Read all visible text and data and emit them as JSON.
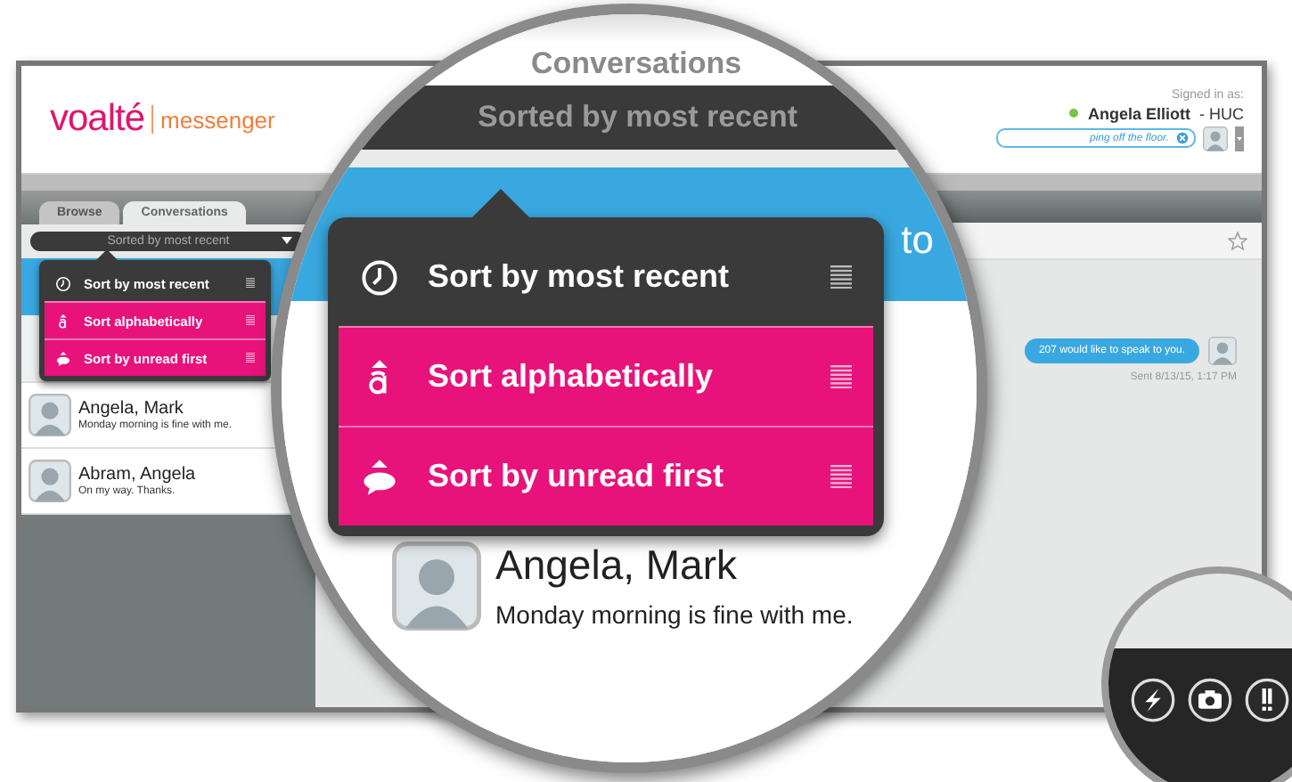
{
  "header": {
    "logo": {
      "brand": "voalté",
      "product": "messenger"
    },
    "signed_in_label": "Signed in as:",
    "user": {
      "name": "Angela Elliott",
      "role": "- HUC"
    },
    "status_field": {
      "value": "ping off the floor."
    }
  },
  "tabs": [
    {
      "label": "Browse",
      "selected": false
    },
    {
      "label": "Conversations",
      "selected": true
    }
  ],
  "sort_dropdown": {
    "value": "Sorted by most recent"
  },
  "sort_menu": [
    {
      "label": "Sort by most recent",
      "selected": true
    },
    {
      "label": "Sort alphabetically",
      "selected": false
    },
    {
      "label": "Sort by unread first",
      "selected": false
    }
  ],
  "conversations": [
    {
      "name": "Angela, Mark",
      "preview": "Monday morning is fine with me."
    },
    {
      "name": "Abram, Angela",
      "preview": "On my way. Thanks."
    }
  ],
  "chat": {
    "messages": [
      {
        "text": "207 would like to speak to you.",
        "time": "Sent 8/13/15, 1:17 PM"
      }
    ]
  },
  "magnifier": {
    "tab": "Conversations",
    "sort_value": "Sorted by most recent",
    "header_fragment": "to",
    "menu": [
      {
        "label": "Sort by most recent",
        "selected": true
      },
      {
        "label": "Sort alphabetically",
        "selected": false
      },
      {
        "label": "Sort by unread first",
        "selected": false
      }
    ],
    "conversation": {
      "name": "Angela, Mark",
      "preview": "Monday morning is fine with me."
    }
  }
}
